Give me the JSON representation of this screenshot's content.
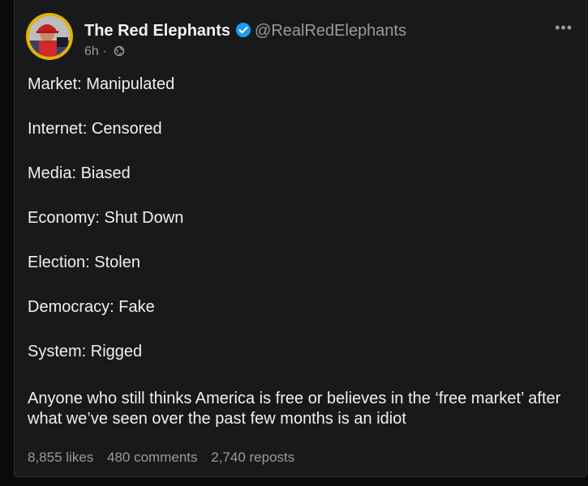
{
  "post": {
    "author_name": "The Red Elephants",
    "handle": "@RealRedElephants",
    "time": "6h",
    "separator": "·",
    "lines": [
      "Market: Manipulated",
      "Internet: Censored",
      "Media: Biased",
      "Economy: Shut Down",
      "Election: Stolen",
      "Democracy: Fake",
      "System: Rigged"
    ],
    "closing": "Anyone who still thinks America is free or believes in the ‘free market’ after what we’ve seen over the past few months is an idiot",
    "likes": "8,855 likes",
    "comments": "480 comments",
    "reposts": "2,740 reposts"
  },
  "icons": {
    "verified": "verified-badge-icon",
    "visibility": "globe-icon",
    "more": "more-options-icon"
  },
  "colors": {
    "background": "#18191a",
    "text": "#f0f0f0",
    "muted": "#9a9a9a",
    "verified": "#1d9bf0"
  }
}
